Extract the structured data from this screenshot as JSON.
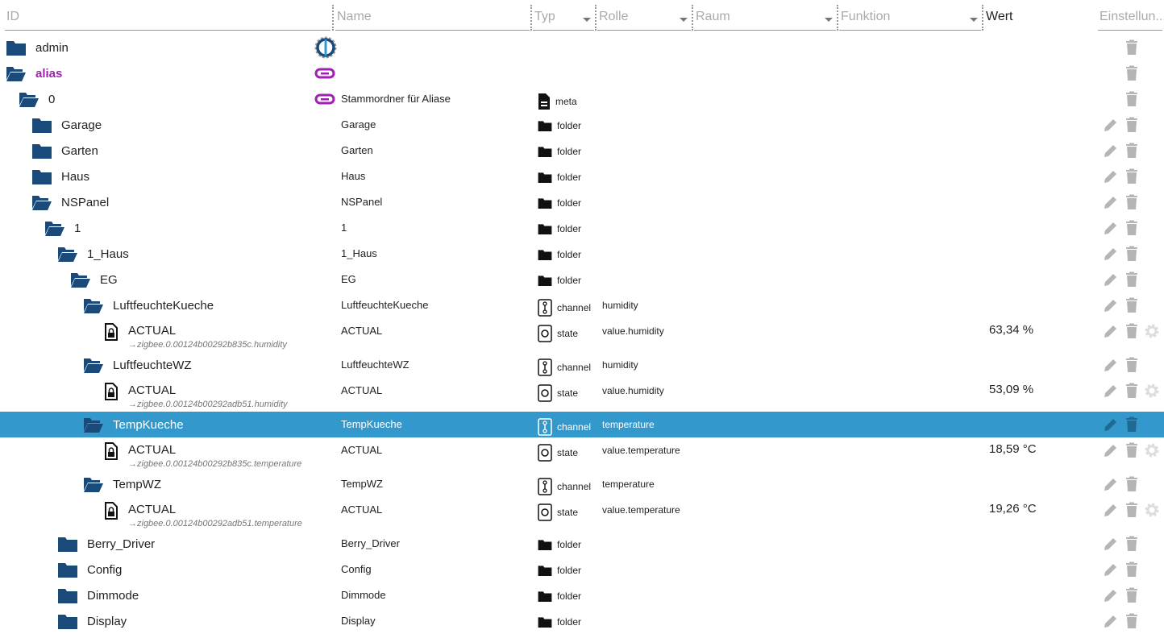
{
  "header": {
    "id": "ID",
    "name": "Name",
    "typ": "Typ",
    "rolle": "Rolle",
    "raum": "Raum",
    "funktion": "Funktion",
    "wert": "Wert",
    "settings": "Einstellun..."
  },
  "colors": {
    "folder": "#1a4a7a",
    "alias": "#a020b0",
    "selected": "#3399cc",
    "icon_gray": "#b5b5b5"
  },
  "rows": [
    {
      "id": "admin",
      "level": 0,
      "kind": "folder",
      "open": false,
      "name_icon": "iobroker-logo-icon",
      "actions": [
        "delete"
      ]
    },
    {
      "id": "alias",
      "level": 0,
      "kind": "folder",
      "open": true,
      "special": "alias",
      "name_icon": "link-icon",
      "actions": [
        "delete"
      ]
    },
    {
      "id": "0",
      "level": 1,
      "kind": "folder",
      "open": true,
      "name_icon": "link-icon",
      "name": "Stammordner für Aliase",
      "type": "meta",
      "actions": [
        "delete"
      ]
    },
    {
      "id": "Garage",
      "level": 2,
      "kind": "folder",
      "open": false,
      "name": "Garage",
      "type": "folder",
      "actions": [
        "edit",
        "delete"
      ]
    },
    {
      "id": "Garten",
      "level": 2,
      "kind": "folder",
      "open": false,
      "name": "Garten",
      "type": "folder",
      "actions": [
        "edit",
        "delete"
      ]
    },
    {
      "id": "Haus",
      "level": 2,
      "kind": "folder",
      "open": false,
      "name": "Haus",
      "type": "folder",
      "actions": [
        "edit",
        "delete"
      ]
    },
    {
      "id": "NSPanel",
      "level": 2,
      "kind": "folder",
      "open": true,
      "name": "NSPanel",
      "type": "folder",
      "actions": [
        "edit",
        "delete"
      ]
    },
    {
      "id": "1",
      "level": 3,
      "kind": "folder",
      "open": true,
      "name": "1",
      "type": "folder",
      "actions": [
        "edit",
        "delete"
      ]
    },
    {
      "id": "1_Haus",
      "level": 4,
      "kind": "folder",
      "open": true,
      "name": "1_Haus",
      "type": "folder",
      "actions": [
        "edit",
        "delete"
      ]
    },
    {
      "id": "EG",
      "level": 5,
      "kind": "folder",
      "open": true,
      "name": "EG",
      "type": "folder",
      "actions": [
        "edit",
        "delete"
      ]
    },
    {
      "id": "LuftfeuchteKueche",
      "level": 6,
      "kind": "folder",
      "open": true,
      "name": "LuftfeuchteKueche",
      "type": "channel",
      "role": "humidity",
      "actions": [
        "edit",
        "delete"
      ]
    },
    {
      "id": "ACTUAL",
      "level": 7,
      "kind": "state",
      "alias": "→zigbee.0.00124b00292b835c.humidity",
      "name": "ACTUAL",
      "type": "state",
      "role": "value.humidity",
      "value": "63,34 %",
      "actions": [
        "edit",
        "delete",
        "settings"
      ]
    },
    {
      "id": "LuftfeuchteWZ",
      "level": 6,
      "kind": "folder",
      "open": true,
      "name": "LuftfeuchteWZ",
      "type": "channel",
      "role": "humidity",
      "actions": [
        "edit",
        "delete"
      ]
    },
    {
      "id": "ACTUAL",
      "level": 7,
      "kind": "state",
      "alias": "→zigbee.0.00124b00292adb51.humidity",
      "name": "ACTUAL",
      "type": "state",
      "role": "value.humidity",
      "value": "53,09 %",
      "actions": [
        "edit",
        "delete",
        "settings"
      ]
    },
    {
      "id": "TempKueche",
      "level": 6,
      "kind": "folder",
      "open": true,
      "selected": true,
      "name": "TempKueche",
      "type": "channel",
      "role": "temperature",
      "actions": [
        "edit",
        "delete"
      ]
    },
    {
      "id": "ACTUAL",
      "level": 7,
      "kind": "state",
      "alias": "→zigbee.0.00124b00292b835c.temperature",
      "name": "ACTUAL",
      "type": "state",
      "role": "value.temperature",
      "value": "18,59 °C",
      "actions": [
        "edit",
        "delete",
        "settings"
      ]
    },
    {
      "id": "TempWZ",
      "level": 6,
      "kind": "folder",
      "open": true,
      "name": "TempWZ",
      "type": "channel",
      "role": "temperature",
      "actions": [
        "edit",
        "delete"
      ]
    },
    {
      "id": "ACTUAL",
      "level": 7,
      "kind": "state",
      "alias": "→zigbee.0.00124b00292adb51.temperature",
      "name": "ACTUAL",
      "type": "state",
      "role": "value.temperature",
      "value": "19,26 °C",
      "actions": [
        "edit",
        "delete",
        "settings"
      ]
    },
    {
      "id": "Berry_Driver",
      "level": 4,
      "kind": "folder",
      "open": false,
      "name": "Berry_Driver",
      "type": "folder",
      "actions": [
        "edit",
        "delete"
      ]
    },
    {
      "id": "Config",
      "level": 4,
      "kind": "folder",
      "open": false,
      "name": "Config",
      "type": "folder",
      "actions": [
        "edit",
        "delete"
      ]
    },
    {
      "id": "Dimmode",
      "level": 4,
      "kind": "folder",
      "open": false,
      "name": "Dimmode",
      "type": "folder",
      "actions": [
        "edit",
        "delete"
      ]
    },
    {
      "id": "Display",
      "level": 4,
      "kind": "folder",
      "open": false,
      "name": "Display",
      "type": "folder",
      "actions": [
        "edit",
        "delete"
      ]
    }
  ]
}
